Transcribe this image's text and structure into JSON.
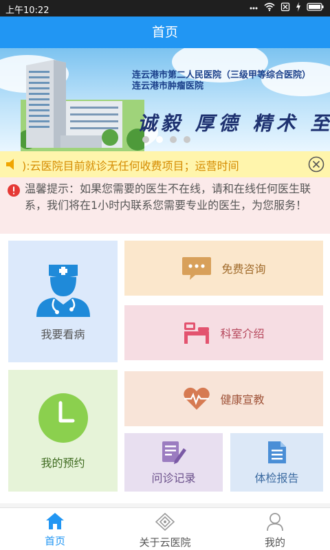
{
  "status_bar": {
    "time": "上午10:22",
    "icons": [
      "signal-dots-icon",
      "wifi-icon",
      "sim-icon",
      "charging-icon",
      "battery-icon"
    ]
  },
  "header": {
    "title": "首页"
  },
  "banner": {
    "line1": "连云港市第二人民医院（三级甲等综合医院）",
    "line2": "连云港市肿瘤医院",
    "motto": "诚毅 厚德 精术 至善",
    "slide_count": 4,
    "active_slide": 2
  },
  "notice": {
    "text": "):云医院目前就诊无任何收费项目；运营时间"
  },
  "tip": {
    "text": "温馨提示：如果您需要的医生不在线，请和在线任何医生联系，我们将在1小时内联系您需要专业的医生，为您服务！"
  },
  "menu": {
    "see_doctor": "我要看病",
    "free_consult": "免费咨询",
    "dept_intro": "科室介绍",
    "my_appointment": "我的预约",
    "health_edu": "健康宣教",
    "visit_record": "问诊记录",
    "checkup_report": "体检报告"
  },
  "tabs": [
    {
      "label": "首页",
      "icon": "home-icon",
      "active": true
    },
    {
      "label": "关于云医院",
      "icon": "hospital-logo-icon",
      "active": false
    },
    {
      "label": "我的",
      "icon": "user-icon",
      "active": false
    }
  ],
  "colors": {
    "primary": "#2196f3",
    "notice_bg": "#fff5ac",
    "notice_text": "#d58b00",
    "tip_bg": "#fbeaea",
    "alert_red": "#e53935"
  }
}
